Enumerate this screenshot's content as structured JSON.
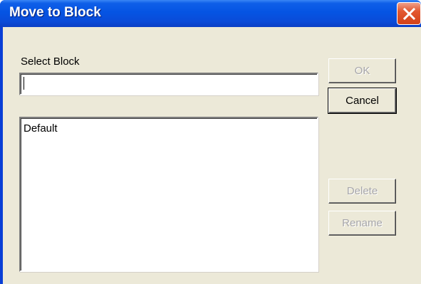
{
  "window": {
    "title": "Move to Block",
    "close_icon": "close-x-icon"
  },
  "form": {
    "select_label": "Select Block",
    "select_value": "",
    "list_items": [
      "Default"
    ]
  },
  "buttons": {
    "ok": {
      "label": "OK",
      "enabled": false
    },
    "cancel": {
      "label": "Cancel",
      "enabled": true
    },
    "delete": {
      "label": "Delete",
      "enabled": false
    },
    "rename": {
      "label": "Rename",
      "enabled": false
    }
  },
  "colors": {
    "titlebar": "#0554e3",
    "client_bg": "#ece9d8",
    "close_button": "#e2572f",
    "disabled_text": "#a7a6aa"
  }
}
